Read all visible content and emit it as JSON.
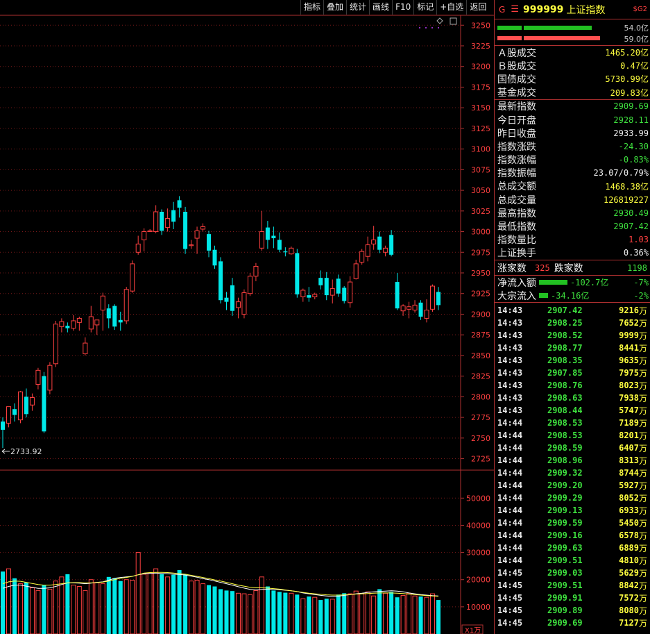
{
  "toolbar": {
    "items": [
      "指标",
      "叠加",
      "统计",
      "画线",
      "F10",
      "标记",
      "+自选",
      "返回"
    ]
  },
  "colors": {
    "up": "#ff4040",
    "down": "#00e8e8",
    "grid": "#7a1a1a",
    "ma1": "#ffffff",
    "ma2": "#ffff40"
  },
  "chart_data": {
    "type": "candlestick",
    "price_axis": {
      "ticks": [
        3250,
        3225,
        3200,
        3175,
        3150,
        3125,
        3100,
        3075,
        3050,
        3025,
        3000,
        2975,
        2950,
        2925,
        2900,
        2875,
        2850,
        2825,
        2800,
        2775,
        2750,
        2725
      ],
      "range": [
        2712,
        3262
      ]
    },
    "low_marker": "2733.92",
    "volume_axis": {
      "ticks": [
        50000,
        40000,
        30000,
        20000,
        10000
      ],
      "range": [
        0,
        58000
      ],
      "unit_label": "X1万"
    },
    "candles": [
      {
        "o": 2770,
        "h": 2775,
        "l": 2738,
        "c": 2760
      },
      {
        "o": 2768,
        "h": 2785,
        "l": 2763,
        "c": 2788
      },
      {
        "o": 2785,
        "h": 2792,
        "l": 2770,
        "c": 2778
      },
      {
        "o": 2772,
        "h": 2807,
        "l": 2768,
        "c": 2806
      },
      {
        "o": 2800,
        "h": 2810,
        "l": 2775,
        "c": 2779
      },
      {
        "o": 2790,
        "h": 2804,
        "l": 2783,
        "c": 2799
      },
      {
        "o": 2815,
        "h": 2835,
        "l": 2809,
        "c": 2832
      },
      {
        "o": 2825,
        "h": 2830,
        "l": 2756,
        "c": 2758
      },
      {
        "o": 2808,
        "h": 2842,
        "l": 2803,
        "c": 2838
      },
      {
        "o": 2840,
        "h": 2892,
        "l": 2836,
        "c": 2888
      },
      {
        "o": 2885,
        "h": 2895,
        "l": 2878,
        "c": 2891
      },
      {
        "o": 2886,
        "h": 2890,
        "l": 2878,
        "c": 2883
      },
      {
        "o": 2883,
        "h": 2899,
        "l": 2880,
        "c": 2892
      },
      {
        "o": 2890,
        "h": 2897,
        "l": 2880,
        "c": 2895
      },
      {
        "o": 2852,
        "h": 2872,
        "l": 2850,
        "c": 2865
      },
      {
        "o": 2882,
        "h": 2910,
        "l": 2878,
        "c": 2897
      },
      {
        "o": 2887,
        "h": 2893,
        "l": 2875,
        "c": 2893
      },
      {
        "o": 2905,
        "h": 2926,
        "l": 2880,
        "c": 2922
      },
      {
        "o": 2907,
        "h": 2912,
        "l": 2883,
        "c": 2895
      },
      {
        "o": 2910,
        "h": 2912,
        "l": 2881,
        "c": 2885
      },
      {
        "o": 2893,
        "h": 2903,
        "l": 2880,
        "c": 2890
      },
      {
        "o": 2892,
        "h": 2933,
        "l": 2888,
        "c": 2930
      },
      {
        "o": 2928,
        "h": 2965,
        "l": 2926,
        "c": 2961
      },
      {
        "o": 2975,
        "h": 2995,
        "l": 2972,
        "c": 2985
      },
      {
        "o": 2990,
        "h": 3004,
        "l": 2976,
        "c": 3000
      },
      {
        "o": 3000,
        "h": 3003,
        "l": 3000,
        "c": 3001
      },
      {
        "o": 3000,
        "h": 3032,
        "l": 2998,
        "c": 3024
      },
      {
        "o": 3024,
        "h": 3027,
        "l": 2996,
        "c": 3001
      },
      {
        "o": 3005,
        "h": 3028,
        "l": 3000,
        "c": 3016
      },
      {
        "o": 3026,
        "h": 3036,
        "l": 3003,
        "c": 3012
      },
      {
        "o": 3038,
        "h": 3043,
        "l": 3017,
        "c": 3029
      },
      {
        "o": 3024,
        "h": 3030,
        "l": 2973,
        "c": 2979
      },
      {
        "o": 2983,
        "h": 2990,
        "l": 2979,
        "c": 2984
      },
      {
        "o": 2992,
        "h": 3006,
        "l": 2973,
        "c": 3001
      },
      {
        "o": 3003,
        "h": 3010,
        "l": 3000,
        "c": 3006
      },
      {
        "o": 2997,
        "h": 3001,
        "l": 2969,
        "c": 2977
      },
      {
        "o": 2978,
        "h": 2983,
        "l": 2955,
        "c": 2959
      },
      {
        "o": 2964,
        "h": 2969,
        "l": 2913,
        "c": 2917
      },
      {
        "o": 2920,
        "h": 2927,
        "l": 2905,
        "c": 2915
      },
      {
        "o": 2935,
        "h": 2944,
        "l": 2898,
        "c": 2904
      },
      {
        "o": 2908,
        "h": 2920,
        "l": 2895,
        "c": 2915
      },
      {
        "o": 2900,
        "h": 2930,
        "l": 2895,
        "c": 2926
      },
      {
        "o": 2925,
        "h": 2950,
        "l": 2922,
        "c": 2946
      },
      {
        "o": 2946,
        "h": 2962,
        "l": 2940,
        "c": 2958
      },
      {
        "o": 2980,
        "h": 3025,
        "l": 2977,
        "c": 3000
      },
      {
        "o": 3005,
        "h": 3013,
        "l": 2979,
        "c": 2990
      },
      {
        "o": 2995,
        "h": 3006,
        "l": 2980,
        "c": 2992
      },
      {
        "o": 2990,
        "h": 2999,
        "l": 2975,
        "c": 2978
      },
      {
        "o": 2976,
        "h": 2981,
        "l": 2970,
        "c": 2975
      },
      {
        "o": 2973,
        "h": 2982,
        "l": 2972,
        "c": 2980
      },
      {
        "o": 2974,
        "h": 2979,
        "l": 2920,
        "c": 2924
      },
      {
        "o": 2921,
        "h": 2931,
        "l": 2915,
        "c": 2929
      },
      {
        "o": 2923,
        "h": 2933,
        "l": 2915,
        "c": 2920
      },
      {
        "o": 2921,
        "h": 2926,
        "l": 2918,
        "c": 2924
      },
      {
        "o": 2944,
        "h": 2953,
        "l": 2930,
        "c": 2935
      },
      {
        "o": 2944,
        "h": 2951,
        "l": 2917,
        "c": 2923
      },
      {
        "o": 2923,
        "h": 2942,
        "l": 2913,
        "c": 2931
      },
      {
        "o": 2943,
        "h": 2948,
        "l": 2921,
        "c": 2925
      },
      {
        "o": 2932,
        "h": 2934,
        "l": 2913,
        "c": 2916
      },
      {
        "o": 2914,
        "h": 2946,
        "l": 2908,
        "c": 2939
      },
      {
        "o": 2943,
        "h": 2966,
        "l": 2942,
        "c": 2961
      },
      {
        "o": 2963,
        "h": 2979,
        "l": 2960,
        "c": 2976
      },
      {
        "o": 2970,
        "h": 2994,
        "l": 2964,
        "c": 2984
      },
      {
        "o": 2985,
        "h": 3007,
        "l": 2978,
        "c": 2990
      },
      {
        "o": 2994,
        "h": 3000,
        "l": 2974,
        "c": 2978
      },
      {
        "o": 2975,
        "h": 2983,
        "l": 2970,
        "c": 2980
      },
      {
        "o": 2996,
        "h": 3002,
        "l": 2970,
        "c": 2972
      },
      {
        "o": 2939,
        "h": 2950,
        "l": 2905,
        "c": 2907
      },
      {
        "o": 2904,
        "h": 2912,
        "l": 2898,
        "c": 2910
      },
      {
        "o": 2906,
        "h": 2915,
        "l": 2895,
        "c": 2909
      },
      {
        "o": 2905,
        "h": 2917,
        "l": 2902,
        "c": 2911
      },
      {
        "o": 2914,
        "h": 2917,
        "l": 2893,
        "c": 2897
      },
      {
        "o": 2895,
        "h": 2918,
        "l": 2890,
        "c": 2905
      },
      {
        "o": 2906,
        "h": 2936,
        "l": 2903,
        "c": 2934
      },
      {
        "o": 2927,
        "h": 2933,
        "l": 2905,
        "c": 2911
      }
    ],
    "volumes": [
      23000,
      24000,
      20500,
      18500,
      19000,
      17000,
      16000,
      18000,
      16500,
      19500,
      21000,
      22000,
      18000,
      17500,
      16000,
      20000,
      19000,
      18500,
      21000,
      20500,
      19500,
      20000,
      19800,
      30000,
      22000,
      22500,
      24000,
      22000,
      21000,
      21800,
      23500,
      22000,
      19500,
      19800,
      18500,
      18000,
      17500,
      16500,
      16000,
      15800,
      15000,
      14800,
      14500,
      16000,
      21000,
      17500,
      16000,
      15500,
      15200,
      15000,
      14500,
      13000,
      13800,
      13500,
      12500,
      13000,
      12800,
      14500,
      15000,
      14800,
      15800,
      14800,
      15500,
      14000,
      16500,
      15000,
      15500,
      13500,
      14200,
      15000,
      14000,
      13800,
      13500,
      14800,
      12500
    ],
    "vol_ma_a": [
      16800,
      17500,
      18000,
      18000,
      17600,
      17200,
      16800,
      16800,
      17000,
      17500,
      18200,
      18800,
      18800,
      18700,
      18500,
      18700,
      19000,
      19200,
      19800,
      20500,
      20800,
      21000,
      21200,
      21800,
      22200,
      22300,
      22400,
      22300,
      22200,
      22000,
      21900,
      21700,
      21300,
      20900,
      20400,
      20000,
      19500,
      19000,
      18500,
      18000,
      17400,
      16900,
      16400,
      16200,
      16400,
      16500,
      16500,
      16300,
      16100,
      15900,
      15600,
      15100,
      14800,
      14500,
      14200,
      14000,
      13800,
      13900,
      14200,
      14500,
      14800,
      15000,
      15300,
      15500,
      15700,
      15800,
      15900,
      15800,
      15500,
      15100,
      14800,
      14500,
      14300,
      14100,
      14000
    ],
    "vol_ma_b": [
      18500,
      19200,
      19500,
      19400,
      19000,
      18600,
      18200,
      18000,
      18000,
      18200,
      18500,
      18800,
      18900,
      18900,
      18800,
      18800,
      18900,
      19100,
      19500,
      20000,
      20500,
      20800,
      21200,
      21800,
      22400,
      22600,
      22700,
      22700,
      22600,
      22400,
      22200,
      22000,
      21600,
      21200,
      20800,
      20400,
      19900,
      19500,
      19000,
      18500,
      18000,
      17600,
      17200,
      17000,
      17000,
      16900,
      16700,
      16500,
      16200,
      15900,
      15600,
      15300,
      15000,
      14800,
      14600,
      14400,
      14300,
      14300,
      14400,
      14500,
      14700,
      14800,
      14900,
      15000,
      15100,
      15100,
      15100,
      15000,
      14900,
      14700,
      14500,
      14300,
      14100,
      14000,
      13900
    ]
  },
  "panel": {
    "header": {
      "g": "G",
      "menu": "☰",
      "code": "999999",
      "name": "上证指数",
      "tag": "$G2"
    },
    "ratio": {
      "green_label": "54.0亿",
      "red_label": "59.0亿"
    },
    "turnover": [
      {
        "k": "Ａ股成交",
        "v": "1465.20亿"
      },
      {
        "k": "Ｂ股成交",
        "v": "0.47亿"
      },
      {
        "k": "国债成交",
        "v": "5730.99亿"
      },
      {
        "k": "基金成交",
        "v": "209.83亿"
      }
    ],
    "stats": [
      {
        "k": "最新指数",
        "v": "2909.69",
        "c": "green"
      },
      {
        "k": "今日开盘",
        "v": "2928.11",
        "c": "green"
      },
      {
        "k": "昨日收盘",
        "v": "2933.99",
        "c": "white"
      },
      {
        "k": "指数涨跌",
        "v": "-24.30",
        "c": "green"
      },
      {
        "k": "指数涨幅",
        "v": "-0.83%",
        "c": "green"
      },
      {
        "k": "指数振幅",
        "v": "23.07/0.79%",
        "c": "white"
      },
      {
        "k": "总成交额",
        "v": "1468.38亿",
        "c": "yellow"
      },
      {
        "k": "总成交量",
        "v": "126819227",
        "c": "yellow"
      },
      {
        "k": "最高指数",
        "v": "2930.49",
        "c": "green"
      },
      {
        "k": "最低指数",
        "v": "2907.42",
        "c": "green"
      },
      {
        "k": "指数量比",
        "v": "1.03",
        "c": "red"
      },
      {
        "k": "上证换手",
        "v": "0.36%",
        "c": "white"
      }
    ],
    "updown": {
      "up_label": "涨家数",
      "up_count": "325",
      "down_label": "跌家数",
      "down_count": "1198"
    },
    "flows": [
      {
        "label": "净流入额",
        "amount": "-102.7亿",
        "pct": "-7%",
        "bar": 0.85
      },
      {
        "label": "大宗流入",
        "amount": "-34.16亿",
        "pct": "-2%",
        "bar": 0.28
      }
    ],
    "ticks": [
      {
        "t": "14:43",
        "p": "2907.42",
        "v": "9216",
        "u": "万"
      },
      {
        "t": "14:43",
        "p": "2908.25",
        "v": "7652",
        "u": "万"
      },
      {
        "t": "14:43",
        "p": "2908.52",
        "v": "9999",
        "u": "万"
      },
      {
        "t": "14:43",
        "p": "2908.77",
        "v": "8441",
        "u": "万"
      },
      {
        "t": "14:43",
        "p": "2908.35",
        "v": "9635",
        "u": "万"
      },
      {
        "t": "14:43",
        "p": "2907.85",
        "v": "7975",
        "u": "万"
      },
      {
        "t": "14:43",
        "p": "2908.76",
        "v": "8023",
        "u": "万"
      },
      {
        "t": "14:43",
        "p": "2908.63",
        "v": "7938",
        "u": "万"
      },
      {
        "t": "14:43",
        "p": "2908.44",
        "v": "5747",
        "u": "万"
      },
      {
        "t": "14:44",
        "p": "2908.53",
        "v": "7189",
        "u": "万"
      },
      {
        "t": "14:44",
        "p": "2908.53",
        "v": "8201",
        "u": "万"
      },
      {
        "t": "14:44",
        "p": "2908.59",
        "v": "6407",
        "u": "万"
      },
      {
        "t": "14:44",
        "p": "2908.96",
        "v": "8313",
        "u": "万"
      },
      {
        "t": "14:44",
        "p": "2909.32",
        "v": "8744",
        "u": "万"
      },
      {
        "t": "14:44",
        "p": "2909.20",
        "v": "5927",
        "u": "万"
      },
      {
        "t": "14:44",
        "p": "2909.29",
        "v": "8052",
        "u": "万"
      },
      {
        "t": "14:44",
        "p": "2909.13",
        "v": "6933",
        "u": "万"
      },
      {
        "t": "14:44",
        "p": "2909.59",
        "v": "5450",
        "u": "万"
      },
      {
        "t": "14:44",
        "p": "2909.16",
        "v": "6578",
        "u": "万"
      },
      {
        "t": "14:44",
        "p": "2909.63",
        "v": "6889",
        "u": "万"
      },
      {
        "t": "14:44",
        "p": "2909.51",
        "v": "4810",
        "u": "万"
      },
      {
        "t": "14:45",
        "p": "2909.03",
        "v": "5629",
        "u": "万"
      },
      {
        "t": "14:45",
        "p": "2909.51",
        "v": "8842",
        "u": "万"
      },
      {
        "t": "14:45",
        "p": "2909.91",
        "v": "7572",
        "u": "万"
      },
      {
        "t": "14:45",
        "p": "2909.89",
        "v": "8080",
        "u": "万"
      },
      {
        "t": "14:45",
        "p": "2909.69",
        "v": "7127",
        "u": "万"
      }
    ]
  }
}
